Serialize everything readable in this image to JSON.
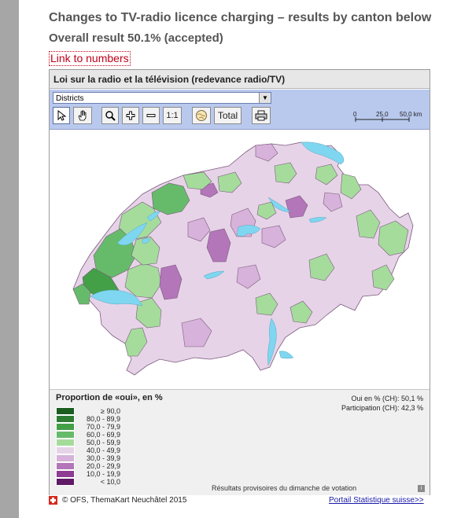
{
  "page": {
    "title": "Changes to TV-radio licence charging – results by canton below",
    "subtitle": "Overall result 50.1% (accepted)",
    "link_label": "Link to numbers"
  },
  "widget": {
    "title": "Loi sur la radio et la télévision (redevance radio/TV)",
    "select": {
      "value": "Districts"
    },
    "toolbar": {
      "tools": [
        {
          "name": "select-tool",
          "icon": "arrow-cursor-icon",
          "label": ""
        },
        {
          "name": "pan-tool",
          "icon": "hand-icon",
          "label": ""
        },
        {
          "name": "zoom-tool",
          "icon": "magnifier-icon",
          "label": ""
        },
        {
          "name": "zoom-in-button",
          "icon": "plus-icon",
          "label": ""
        },
        {
          "name": "zoom-out-button",
          "icon": "minus-icon",
          "label": ""
        },
        {
          "name": "one-to-one-button",
          "icon": "",
          "label": "1:1"
        },
        {
          "name": "reset-view-button",
          "icon": "globe-icon",
          "label": ""
        },
        {
          "name": "total-button",
          "icon": "",
          "label": "Total"
        },
        {
          "name": "print-button",
          "icon": "printer-icon",
          "label": ""
        }
      ],
      "scale": {
        "labels": [
          "0",
          "25,0",
          "50,0 km"
        ]
      }
    }
  },
  "legend": {
    "title": "Proportion de «oui», en %",
    "stats": [
      "Oui en % (CH): 50,1 %",
      "Participation (CH): 42,3 %"
    ],
    "classes": [
      {
        "label": "≥ 90,0",
        "color": "#1b5e20"
      },
      {
        "label": "80,0 - 89,9",
        "color": "#2e7d32"
      },
      {
        "label": "70,0 - 79,9",
        "color": "#43a047"
      },
      {
        "label": "60,0 - 69,9",
        "color": "#66bb6a"
      },
      {
        "label": "50,0 - 59,9",
        "color": "#a5dc9c"
      },
      {
        "label": "40,0 - 49,9",
        "color": "#e7d3e8"
      },
      {
        "label": "30,0 - 39,9",
        "color": "#d7b2da"
      },
      {
        "label": "20,0 - 29,9",
        "color": "#b376b9"
      },
      {
        "label": "10,0 - 19,9",
        "color": "#8e3b94"
      },
      {
        "label": "< 10,0",
        "color": "#5f1a66"
      }
    ],
    "footnote": "Résultats provisoires du dimanche de votation",
    "info_icon": "info-icon"
  },
  "footer": {
    "copyright": "© OFS, ThemaKart Neuchâtel 2015",
    "portal_link": "Portail Statistique suisse>>"
  },
  "map": {
    "colors": {
      "no_light": "#e7d3e8",
      "no_mid": "#d7b2da",
      "no_strong": "#b376b9",
      "yes_light": "#a5dc9c",
      "yes_mid": "#66bb6a",
      "yes_strong": "#43a047",
      "lake": "#7fd6f0",
      "border": "#7a5b7c"
    }
  }
}
